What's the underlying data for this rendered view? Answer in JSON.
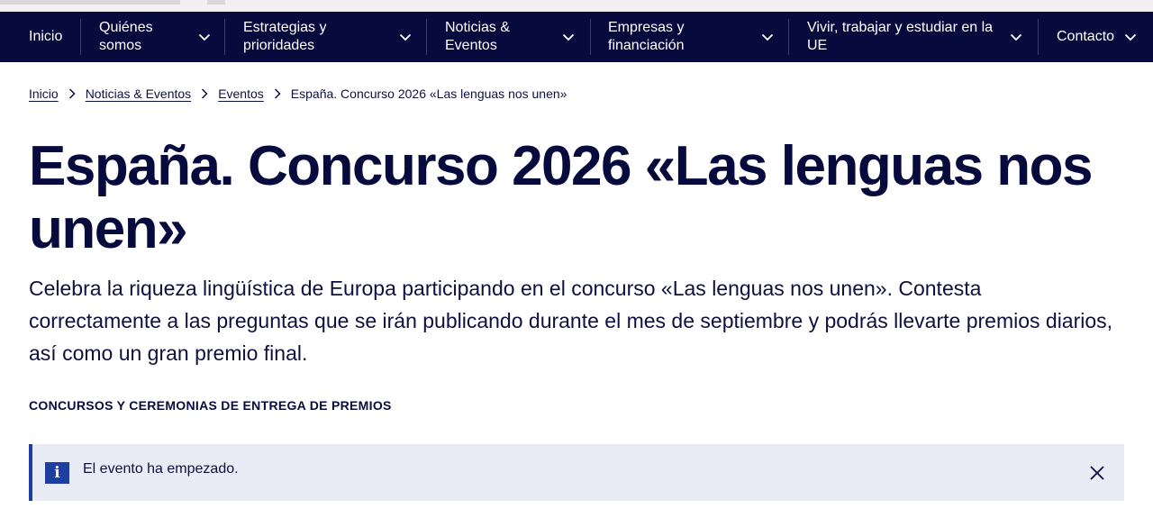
{
  "colors": {
    "nav_background": "#070a3d",
    "nav_text": "#ffffff",
    "title_text": "#070a3d",
    "notice_background": "#e9ebf5",
    "notice_accent": "#1d3fa1"
  },
  "nav": {
    "items": [
      {
        "label": "Inicio",
        "has_dropdown": false
      },
      {
        "label": "Quiénes\nsomos",
        "has_dropdown": true
      },
      {
        "label": "Estrategias y\nprioridades",
        "has_dropdown": true
      },
      {
        "label": "Noticias &\nEventos",
        "has_dropdown": true
      },
      {
        "label": "Empresas y\nfinanciación",
        "has_dropdown": true
      },
      {
        "label": "Vivir, trabajar y estudiar en la\nUE",
        "has_dropdown": true
      },
      {
        "label": "Contacto",
        "has_dropdown": true
      }
    ],
    "dropdown_icon": "chevron-down-icon"
  },
  "breadcrumb": {
    "links": [
      "Inicio",
      "Noticias & Eventos",
      "Eventos"
    ],
    "current": "España. Concurso 2026 «Las lenguas nos unen»",
    "separator_icon": "chevron-right-icon"
  },
  "page": {
    "title": "España. Concurso 2026 «Las lenguas nos unen»",
    "lead": "Celebra la riqueza lingüística de Europa participando en el concurso «Las lenguas nos unen». Contesta correctamente a las preguntas que se irán publicando durante el mes de septiembre y podrás llevarte premios diarios, así como un gran premio final.",
    "category": "CONCURSOS Y CEREMONIAS DE ENTREGA DE PREMIOS"
  },
  "notice": {
    "icon": "info-icon",
    "icon_glyph": "i",
    "text": "El evento ha empezado.",
    "close_icon": "close-icon"
  }
}
